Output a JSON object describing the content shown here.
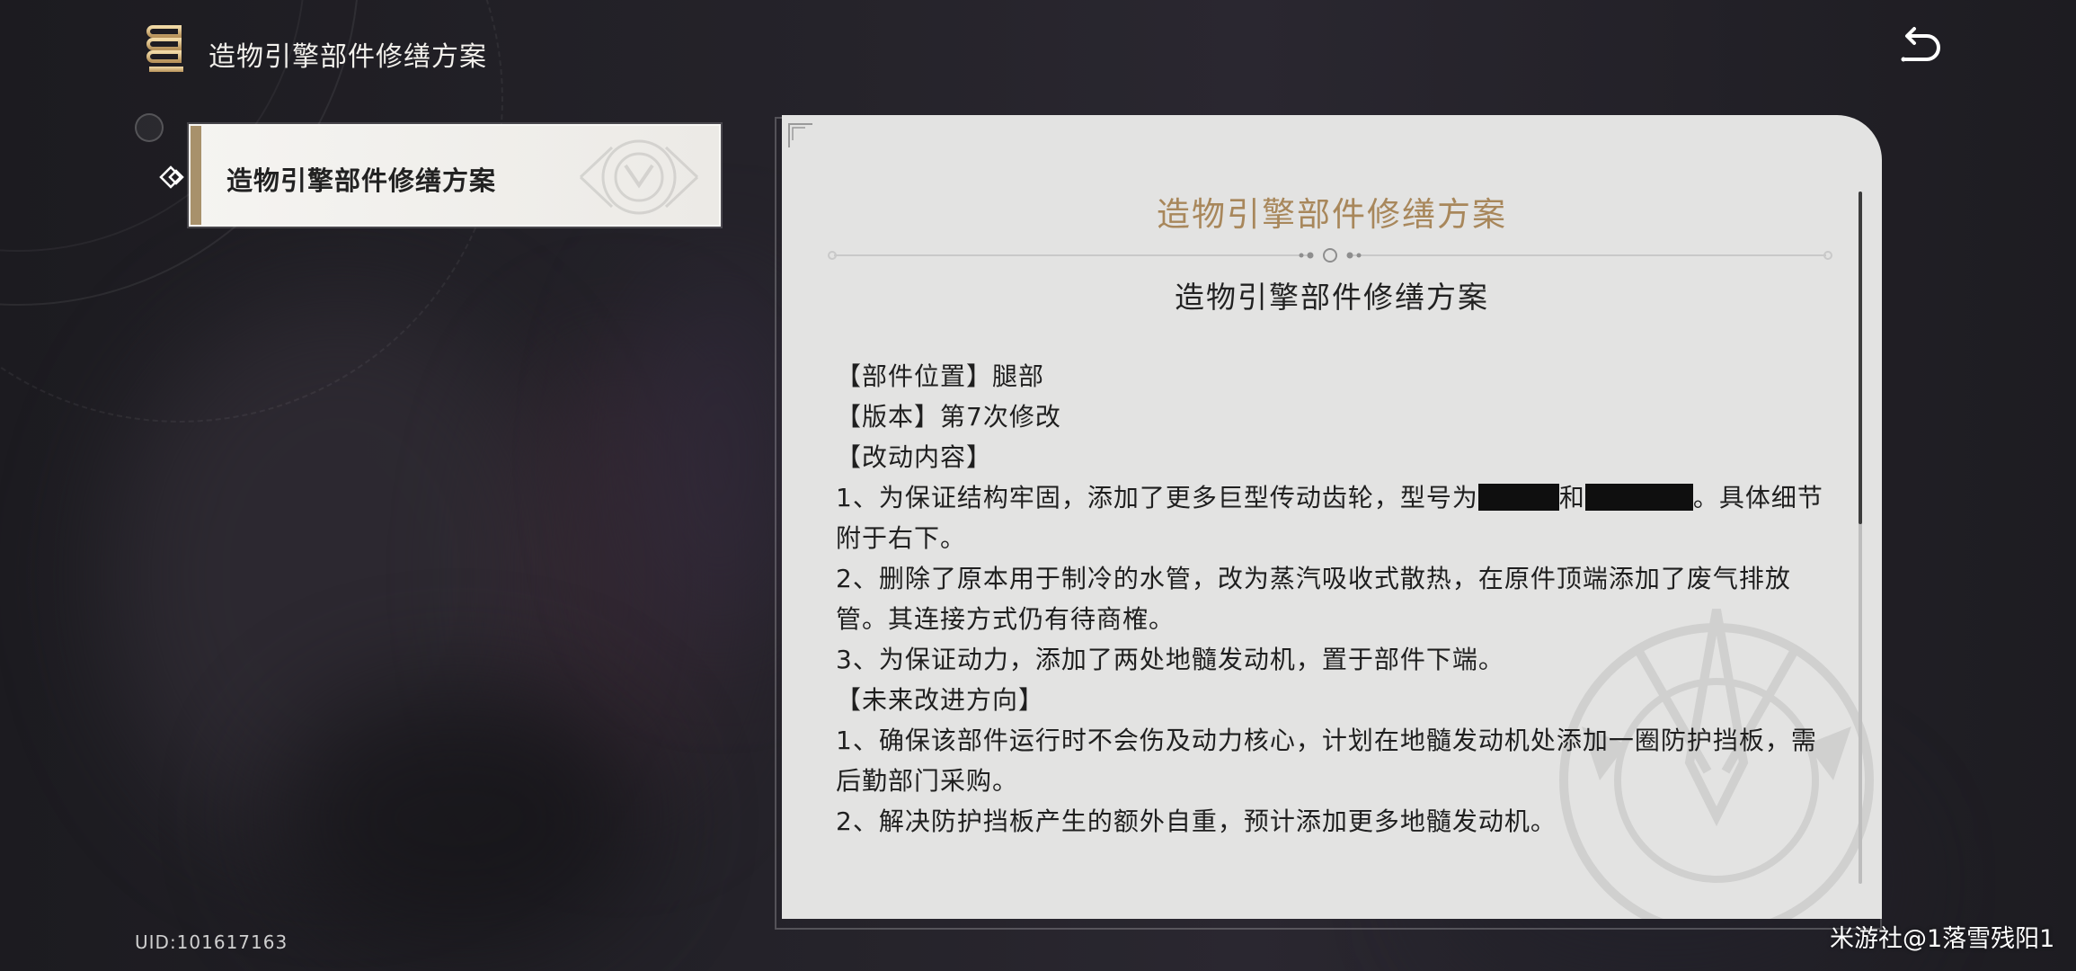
{
  "header": {
    "title": "造物引擎部件修缮方案",
    "icon": "book-icon",
    "back_icon": "back-arrow-icon"
  },
  "sidebar": {
    "items": [
      {
        "label": "造物引擎部件修缮方案",
        "selected": true
      }
    ]
  },
  "document": {
    "heading": "造物引擎部件修缮方案",
    "subtitle": "造物引擎部件修缮方案",
    "lines": {
      "position": "【部件位置】腿部",
      "version": "【版本】第7次修改",
      "changes_header": "【改动内容】",
      "change1_before": "1、为保证结构牢固，添加了更多巨型传动齿轮，型号为",
      "change1_mid": "和",
      "change1_after": "。具体细节附于右下。",
      "change2": "2、删除了原本用于制冷的水管，改为蒸汽吸收式散热，在原件顶端添加了废气排放管。其连接方式仍有待商榷。",
      "change3": "3、为保证动力，添加了两处地髓发动机，置于部件下端。",
      "future_header": "【未来改进方向】",
      "future1": "1、确保该部件运行时不会伤及动力核心，计划在地髓发动机处添加一圈防护挡板，需后勤部门采购。",
      "future2": "2、解决防护挡板产生的额外自重，预计添加更多地髓发动机。"
    }
  },
  "footer": {
    "uid": "UID:101617163",
    "credit": "米游社@1落雪残阳1"
  },
  "colors": {
    "accent_gold": "#a8875b",
    "selected_bar": "#a8916b",
    "panel_bg": "#e3e3e2"
  }
}
